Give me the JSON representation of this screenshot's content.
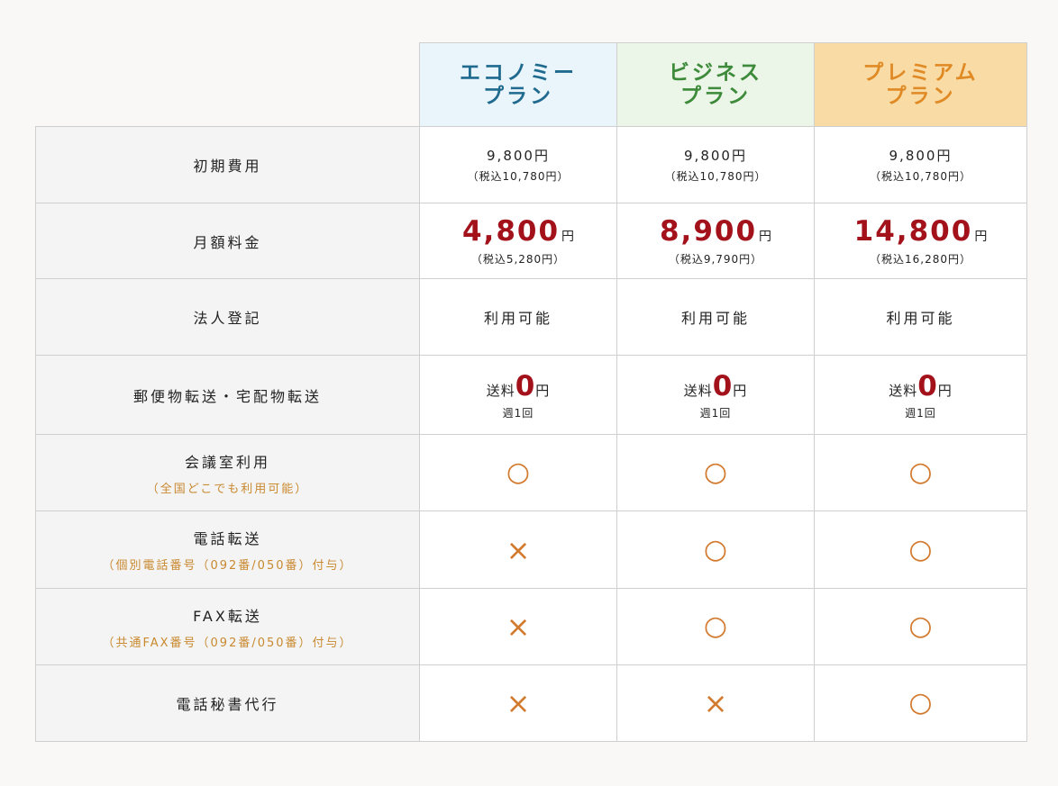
{
  "plans": [
    {
      "line1": "エコノミー",
      "line2": "プラン"
    },
    {
      "line1": "ビジネス",
      "line2": "プラン"
    },
    {
      "line1": "プレミアム",
      "line2": "プラン"
    }
  ],
  "rows": {
    "initial_fee": {
      "label": "初期費用",
      "values": [
        {
          "base": "9,800円",
          "tax": "（税込10,780円）"
        },
        {
          "base": "9,800円",
          "tax": "（税込10,780円）"
        },
        {
          "base": "9,800円",
          "tax": "（税込10,780円）"
        }
      ]
    },
    "monthly_fee": {
      "label": "月額料金",
      "yen": "円",
      "values": [
        {
          "amount": "4,800",
          "tax": "（税込5,280円）"
        },
        {
          "amount": "8,900",
          "tax": "（税込9,790円）"
        },
        {
          "amount": "14,800",
          "tax": "（税込16,280円）"
        }
      ]
    },
    "corporate_registration": {
      "label": "法人登記",
      "values": [
        "利用可能",
        "利用可能",
        "利用可能"
      ]
    },
    "mail_forwarding": {
      "label": "郵便物転送・宅配物転送",
      "values": [
        {
          "prefix": "送料",
          "amount": "0",
          "yen": "円",
          "freq": "週1回"
        },
        {
          "prefix": "送料",
          "amount": "0",
          "yen": "円",
          "freq": "週1回"
        },
        {
          "prefix": "送料",
          "amount": "0",
          "yen": "円",
          "freq": "週1回"
        }
      ]
    },
    "meeting_room": {
      "label": "会議室利用",
      "note": "（全国どこでも利用可能）",
      "values": [
        "○",
        "○",
        "○"
      ]
    },
    "phone_forwarding": {
      "label": "電話転送",
      "note": "（個別電話番号（092番/050番）付与）",
      "values": [
        "×",
        "○",
        "○"
      ]
    },
    "fax_forwarding": {
      "label": "FAX転送",
      "note": "（共通FAX番号（092番/050番）付与）",
      "values": [
        "×",
        "○",
        "○"
      ]
    },
    "phone_secretary": {
      "label": "電話秘書代行",
      "values": [
        "×",
        "×",
        "○"
      ]
    }
  },
  "colors": {
    "economy_header_bg": "#eaf5fb",
    "business_header_bg": "#ebf5e8",
    "premium_header_bg": "#f9dca5",
    "price_red": "#a3111a",
    "mark_orange": "#d27a2e"
  }
}
